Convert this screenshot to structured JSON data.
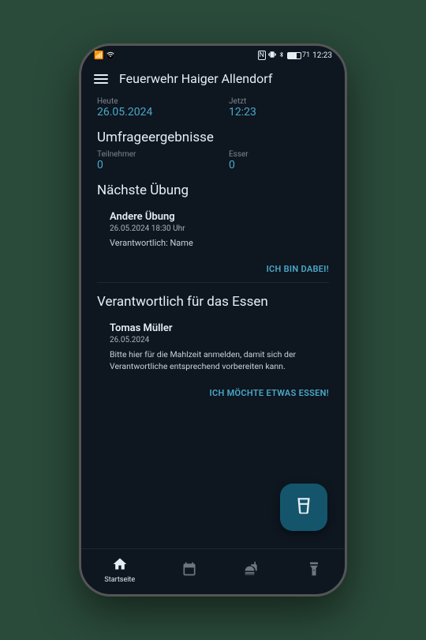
{
  "status": {
    "time": "12:23",
    "battery": "71"
  },
  "header": {
    "title": "Feuerwehr Haiger Allendorf"
  },
  "today": {
    "label": "Heute",
    "value": "26.05.2024"
  },
  "now": {
    "label": "Jetzt",
    "value": "12:23"
  },
  "poll": {
    "heading": "Umfrageergebnisse",
    "participants_label": "Teilnehmer",
    "participants_value": "0",
    "eaters_label": "Esser",
    "eaters_value": "0"
  },
  "next_training": {
    "heading": "Nächste Übung",
    "title": "Andere Übung",
    "datetime": "26.05.2024 18:30 Uhr",
    "responsible": "Verantwortlich: Name",
    "action": "ICH BIN DABEI!"
  },
  "food": {
    "heading": "Verantwortlich für das Essen",
    "person": "Tomas Müller",
    "date": "26.05.2024",
    "desc": "Bitte hier für die Mahlzeit anmelden, damit sich der Verantwortliche entsprechend vorbereiten kann.",
    "action": "ICH MÖCHTE ETWAS ESSEN!"
  },
  "nav": {
    "home": "Startseite"
  }
}
